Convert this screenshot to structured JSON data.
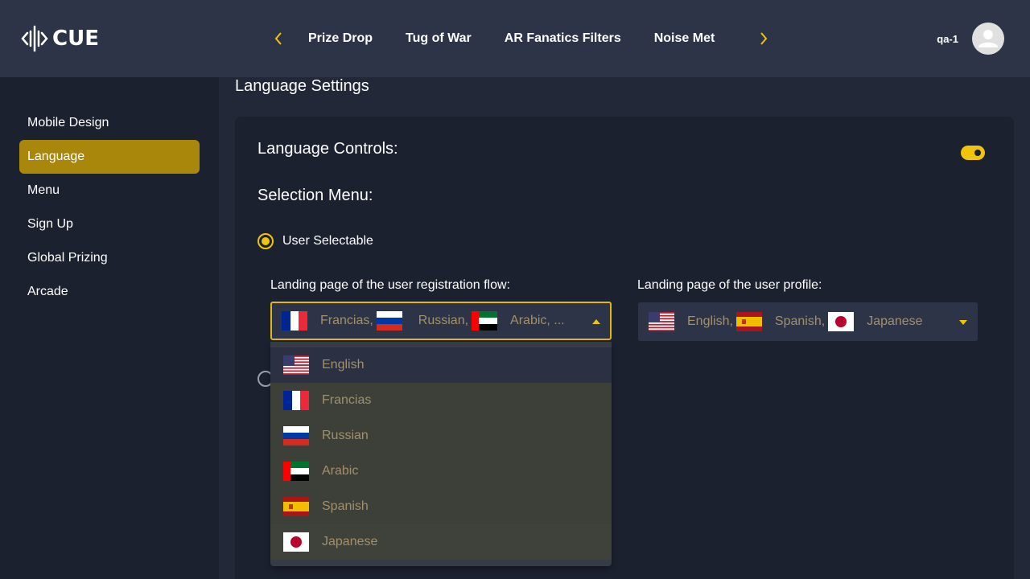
{
  "brand": {
    "name": "CUE"
  },
  "nav": {
    "tabs": [
      "Prize Drop",
      "Tug of War",
      "AR Fanatics Filters",
      "Noise Met"
    ],
    "prev_icon": "chevron-left-icon",
    "next_icon": "chevron-right-icon"
  },
  "user": {
    "name": "qa-1",
    "avatar_icon": "user-avatar-icon"
  },
  "sidebar": {
    "items": [
      {
        "label": "Mobile Design",
        "active": false
      },
      {
        "label": "Language",
        "active": true
      },
      {
        "label": "Menu",
        "active": false
      },
      {
        "label": "Sign Up",
        "active": false
      },
      {
        "label": "Global Prizing",
        "active": false
      },
      {
        "label": "Arcade",
        "active": false
      }
    ]
  },
  "main": {
    "title": "Language Settings",
    "controls_heading": "Language Controls:",
    "controls_toggle_on": true,
    "selection_heading": "Selection Menu:",
    "radio_user_selectable": "User Selectable",
    "registration": {
      "label": "Landing page of the user registration flow:",
      "chips": [
        "Francias,",
        "Russian,",
        "Arabic, ..."
      ]
    },
    "profile": {
      "label": "Landing page of the user profile:",
      "chips": [
        "English,",
        "Spanish,",
        "Japanese"
      ]
    },
    "dropdown_options": [
      "English",
      "Francias",
      "Russian",
      "Arabic",
      "Spanish",
      "Japanese"
    ]
  },
  "colors": {
    "accent": "#f0c40d",
    "sidebar_active": "#a8870a",
    "option_text": "#a38f6a",
    "header_bg": "#2d3447",
    "page_bg": "#222838"
  }
}
